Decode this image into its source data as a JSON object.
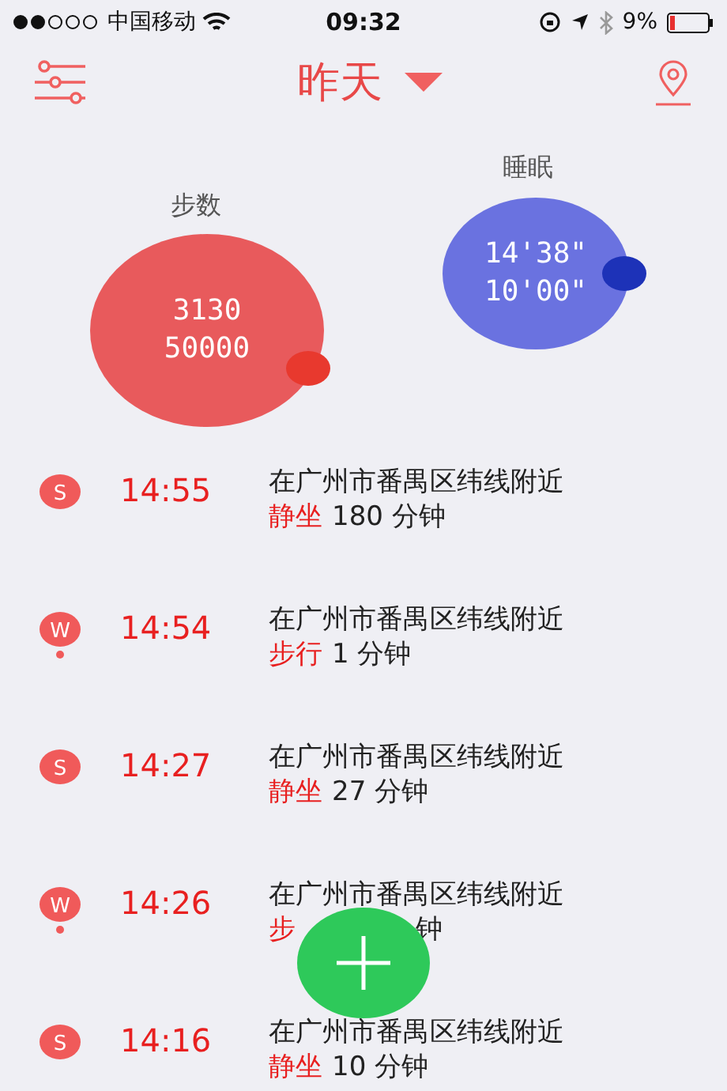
{
  "status_bar": {
    "carrier": "中国移动",
    "time": "09:32",
    "battery": "9%"
  },
  "nav": {
    "title": "昨天"
  },
  "summary": [
    {
      "kind": "steps",
      "label": "步数",
      "lines": [
        "3130",
        "50000"
      ],
      "color": "#e85a5c"
    },
    {
      "kind": "sleep",
      "label": "睡眠",
      "lines": [
        "14'38\"",
        "10'00\""
      ],
      "color": "#6a72e0"
    }
  ],
  "activities": [
    {
      "kind": "sit",
      "badge": "S",
      "time": "14:55",
      "place": "在广州市番禺区纬线附近",
      "activity": "静坐",
      "rest": "180 分钟"
    },
    {
      "kind": "walk",
      "badge": "W",
      "time": "14:54",
      "place": "在广州市番禺区纬线附近",
      "activity": "步行",
      "rest": "1 分钟"
    },
    {
      "kind": "sit",
      "badge": "S",
      "time": "14:27",
      "place": "在广州市番禺区纬线附近",
      "activity": "静坐",
      "rest": "27 分钟"
    },
    {
      "kind": "walk",
      "badge": "W",
      "time": "14:26",
      "place": "在广州市番禺区纬线附近",
      "activity": "步",
      "rest": "钟",
      "covered": true
    },
    {
      "kind": "sit",
      "badge": "S",
      "time": "14:16",
      "place": "在广州市番禺区纬线附近",
      "activity": "静坐",
      "rest": "10 分钟"
    }
  ]
}
